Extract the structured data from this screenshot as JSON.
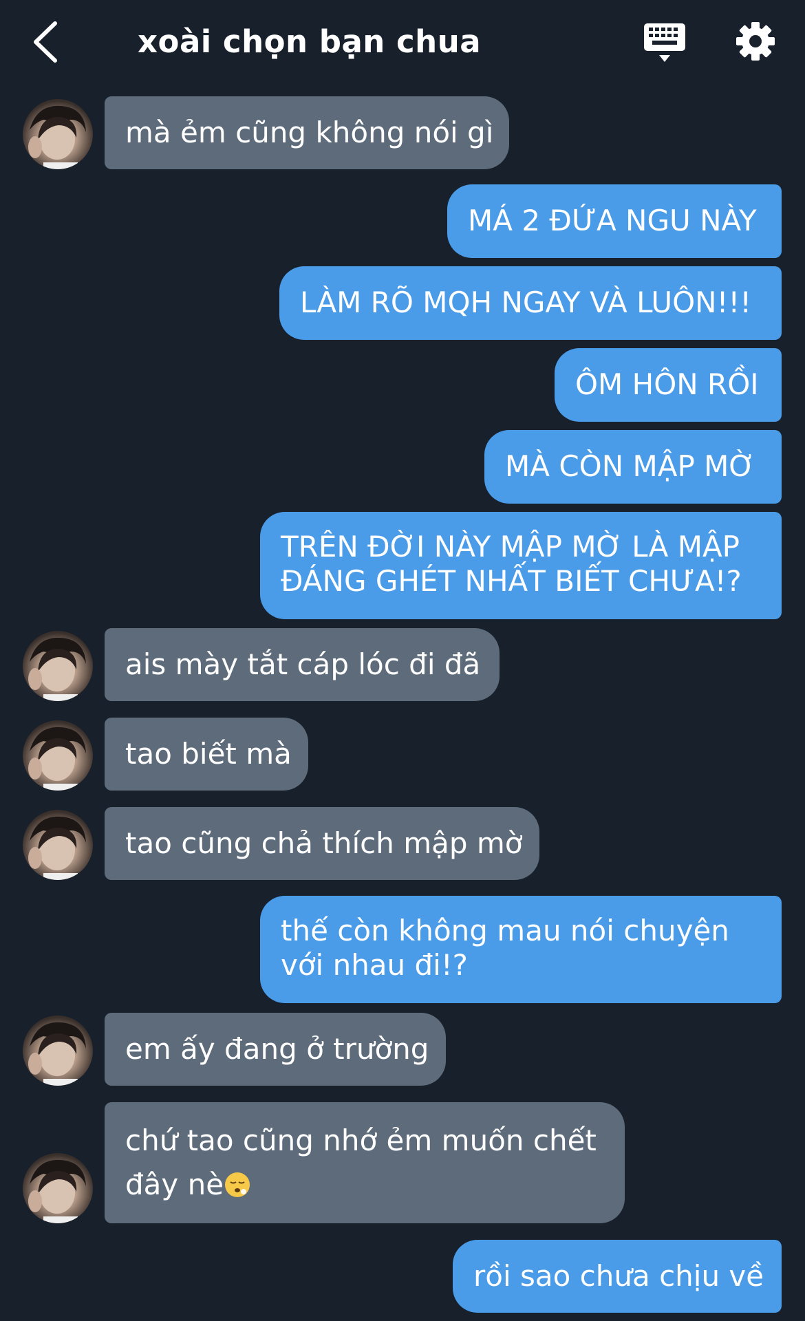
{
  "header": {
    "title": "xoài chọn bạn chua",
    "back_icon": "chevron-left-icon",
    "keyboard_icon": "keyboard-icon",
    "settings_icon": "gear-icon"
  },
  "colors": {
    "background": "#18202b",
    "incoming_bubble": "#5d6b7a",
    "outgoing_bubble": "#4a9be8"
  },
  "messages": [
    {
      "side": "in",
      "text": "mà ẻm cũng không nói gì"
    },
    {
      "side": "out",
      "text": "MÁ 2 ĐỨA NGU NÀY"
    },
    {
      "side": "out",
      "text": "LÀM RÕ MQH NGAY VÀ LUÔN!!!"
    },
    {
      "side": "out",
      "text": "ÔM HÔN RỒI"
    },
    {
      "side": "out",
      "text": "MÀ CÒN MẬP MỜ"
    },
    {
      "side": "out",
      "text_line1": "TRÊN ĐỜI NÀY MẬP MỜ LÀ MẬP",
      "text_line2": "ĐÁNG GHÉT NHẤT BIẾT CHƯA!?"
    },
    {
      "side": "in",
      "text": "ais mày tắt cáp lóc đi đã"
    },
    {
      "side": "in",
      "text": "tao biết mà"
    },
    {
      "side": "in",
      "text": "tao cũng chả thích mập mờ"
    },
    {
      "side": "out",
      "text_line1": "thế còn không mau nói chuyện",
      "text_line2": "với nhau đi!?"
    },
    {
      "side": "in",
      "text": "em ấy đang ở trường"
    },
    {
      "side": "in",
      "text_line1": "chứ tao cũng nhớ ẻm muốn chết",
      "text_line2": "đây nè",
      "emoji": "relieved-face-emoji"
    },
    {
      "side": "out",
      "text": "rồi sao chưa chịu về"
    }
  ]
}
